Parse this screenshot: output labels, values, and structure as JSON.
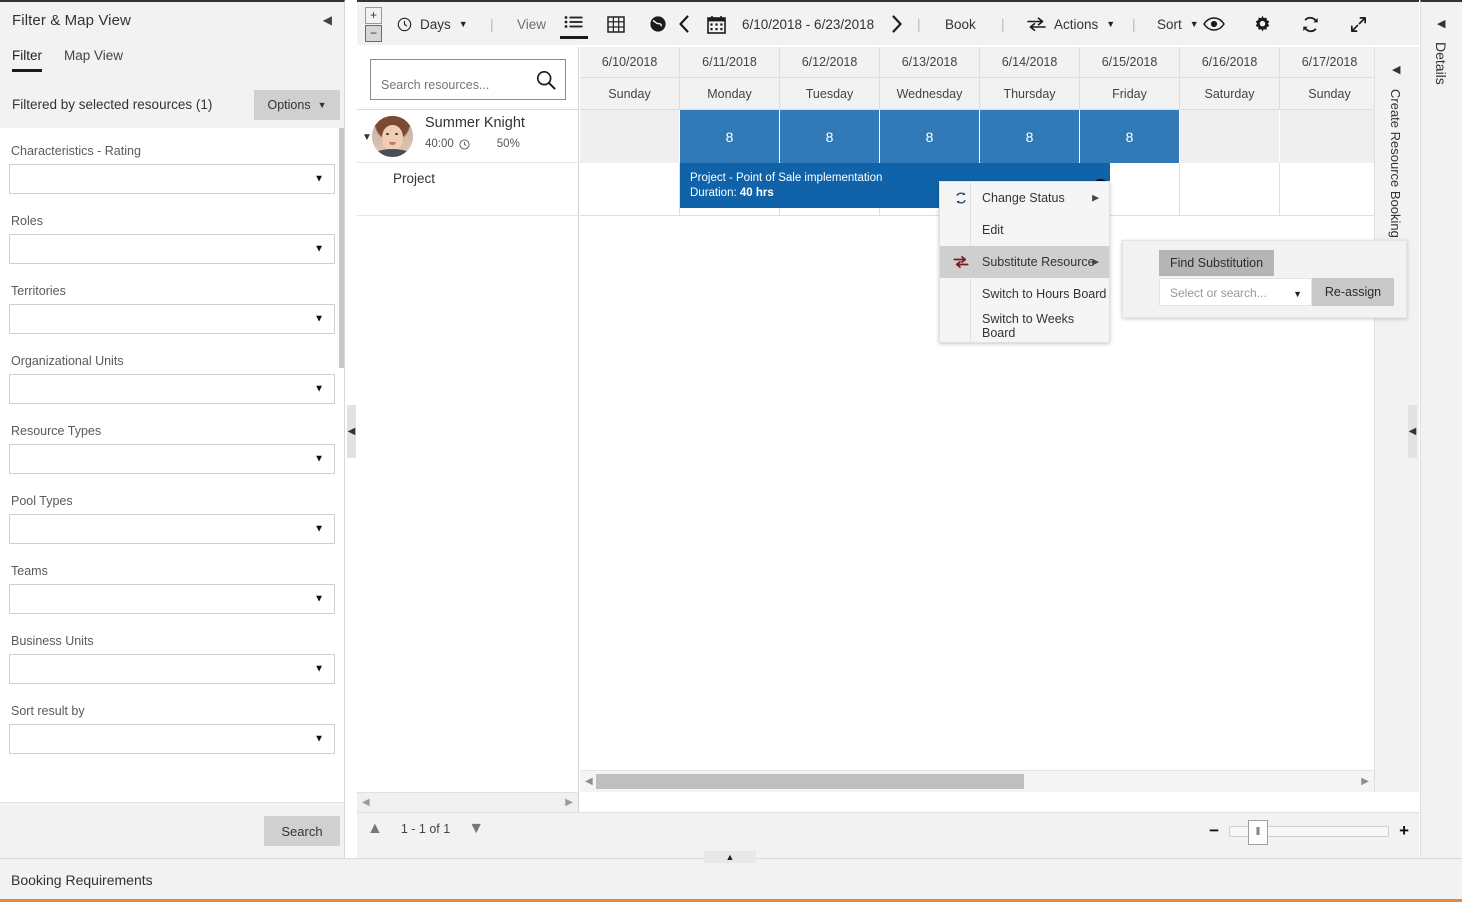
{
  "filter_panel": {
    "title": "Filter & Map View",
    "collapse_icon": "chevron-left-icon",
    "tabs": [
      {
        "label": "Filter",
        "active": true
      },
      {
        "label": "Map View",
        "active": false
      }
    ],
    "summary": "Filtered by selected resources (1)",
    "options_button": "Options",
    "fields": [
      {
        "label": "Characteristics - Rating",
        "value": ""
      },
      {
        "label": "Roles",
        "value": ""
      },
      {
        "label": "Territories",
        "value": ""
      },
      {
        "label": "Organizational Units",
        "value": ""
      },
      {
        "label": "Resource Types",
        "value": ""
      },
      {
        "label": "Pool Types",
        "value": ""
      },
      {
        "label": "Teams",
        "value": ""
      },
      {
        "label": "Business Units",
        "value": ""
      },
      {
        "label": "Sort result by",
        "value": ""
      }
    ],
    "search_button": "Search"
  },
  "toolbar": {
    "expand_icon": "plus-box-icon",
    "collapse_icon": "minus-box-icon",
    "scale_label": "Days",
    "view_label": "View",
    "view_buttons": [
      {
        "name": "list-view-icon",
        "active": true
      },
      {
        "name": "grid-view-icon",
        "active": false
      },
      {
        "name": "globe-view-icon",
        "active": false
      }
    ],
    "prev_icon": "chevron-left-icon",
    "calendar_icon": "calendar-icon",
    "date_range": "6/10/2018 - 6/23/2018",
    "next_icon": "chevron-right-icon",
    "book_label": "Book",
    "actions_label": "Actions",
    "sort_label": "Sort",
    "right_icons": [
      "eye-icon",
      "gear-icon",
      "refresh-icon",
      "fullscreen-icon"
    ]
  },
  "resources": {
    "search_placeholder": "Search resources...",
    "search_value": "",
    "search_icon": "search-icon",
    "rows": [
      {
        "name": "Summer Knight",
        "hours": "40:00",
        "clock_icon": "clock-icon",
        "utilization": "50%",
        "child": "Project"
      }
    ],
    "paging_text": "1 - 1 of 1",
    "page_up_icon": "chevron-up-icon",
    "page_down_icon": "chevron-down-icon"
  },
  "timeline": {
    "dates": [
      "6/10/2018",
      "6/11/2018",
      "6/12/2018",
      "6/13/2018",
      "6/14/2018",
      "6/15/2018",
      "6/16/2018",
      "6/17/2018"
    ],
    "weekdays": [
      "Sunday",
      "Monday",
      "Tuesday",
      "Wednesday",
      "Thursday",
      "Friday",
      "Saturday",
      "Sunday"
    ],
    "capacity": [
      "",
      "8",
      "8",
      "8",
      "8",
      "8",
      "",
      ""
    ],
    "booking": {
      "title": "Project - Point of Sale implementation",
      "duration_label": "Duration:",
      "duration_value": "40 hrs",
      "status_icon": "status-dot-icon"
    },
    "colors": {
      "capacity_blue": "#3279b7",
      "booking_blue": "#1063a8",
      "accent_orange": "#e08a3c"
    }
  },
  "zoom_control": {
    "minus": "−",
    "plus": "+",
    "thumb_icon": "slider-thumb-icon"
  },
  "rails": {
    "create_resource_booking": "Create Resource Booking",
    "details": "Details",
    "arrow_icon": "chevron-left-icon"
  },
  "booking_requirements": {
    "label": "Booking Requirements"
  },
  "context_menu": {
    "items": [
      {
        "label": "Change Status",
        "icon": "change-status-icon",
        "submenu": true,
        "highlighted": false
      },
      {
        "label": "Edit",
        "icon": "",
        "submenu": false,
        "highlighted": false
      },
      {
        "label": "Substitute Resource",
        "icon": "substitute-icon",
        "submenu": true,
        "highlighted": true
      },
      {
        "label": "Switch to Hours Board",
        "icon": "",
        "submenu": false,
        "highlighted": false
      },
      {
        "label": "Switch to Weeks Board",
        "icon": "",
        "submenu": false,
        "highlighted": false
      }
    ]
  },
  "substitution_flyout": {
    "title": "Find Substitution",
    "select_placeholder": "Select or search...",
    "select_value": "",
    "reassign_button": "Re-assign"
  }
}
